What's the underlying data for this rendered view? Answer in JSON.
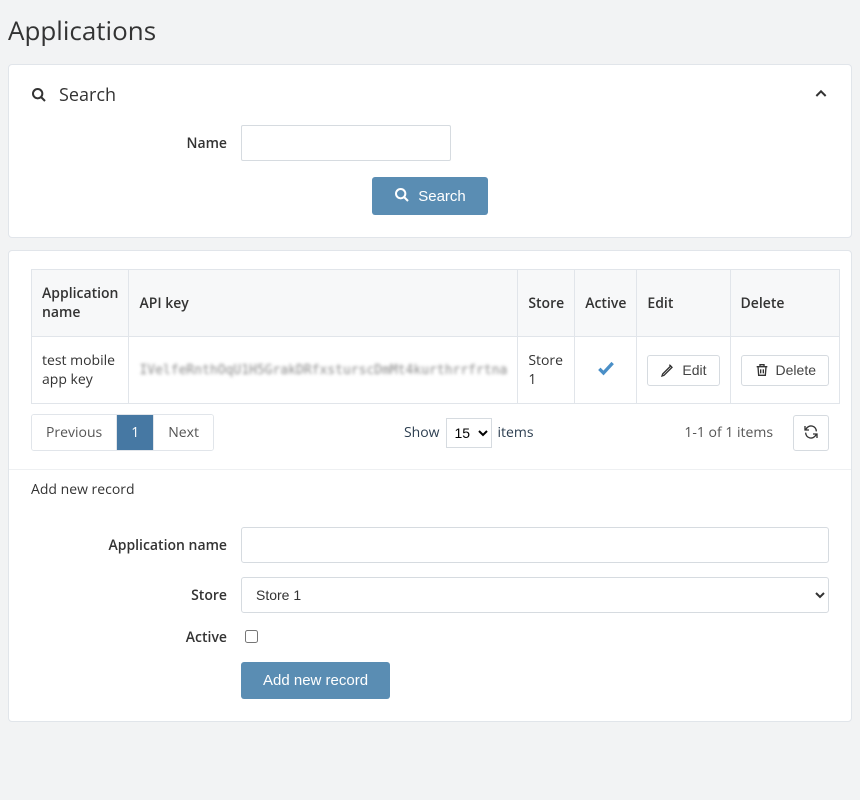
{
  "page": {
    "title": "Applications"
  },
  "search": {
    "panel_title": "Search",
    "name_label": "Name",
    "name_value": "",
    "submit_label": "Search"
  },
  "table": {
    "headers": {
      "app_name": "Application name",
      "api_key": "API key",
      "store": "Store",
      "active": "Active",
      "edit": "Edit",
      "delete": "Delete"
    },
    "rows": [
      {
        "app_name": "test mobile app key",
        "api_key": "IVelfeRnthOqU1H5GrakDRfxsturscDmMt4kurthrrfrtna",
        "store": "Store 1",
        "active": true,
        "edit_label": "Edit",
        "delete_label": "Delete"
      }
    ],
    "pager": {
      "previous_label": "Previous",
      "pages": [
        "1"
      ],
      "next_label": "Next"
    },
    "show_label": "Show",
    "items_label": "items",
    "page_size_selected": "15",
    "count_text": "1-1 of 1 items"
  },
  "add": {
    "heading": "Add new record",
    "app_name_label": "Application name",
    "app_name_value": "",
    "store_label": "Store",
    "store_selected": "Store 1",
    "store_options": [
      "Store 1"
    ],
    "active_label": "Active",
    "active_checked": false,
    "submit_label": "Add new record"
  }
}
